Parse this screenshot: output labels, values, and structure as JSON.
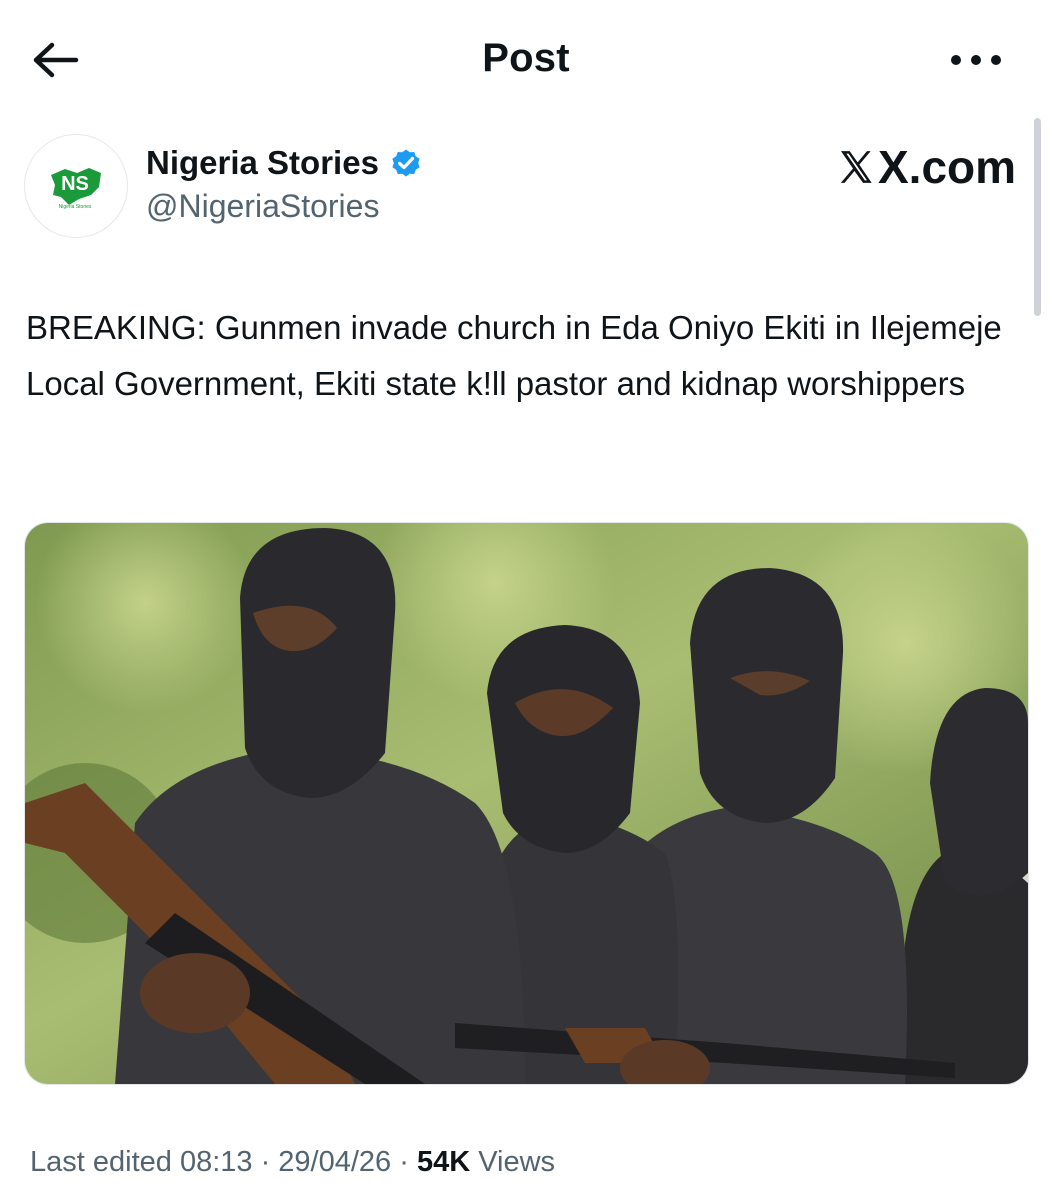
{
  "header": {
    "title": "Post",
    "back_icon": "arrow-left-icon",
    "more_icon": "more-horizontal-icon"
  },
  "author": {
    "name": "Nigeria Stories",
    "handle": "@NigeriaStories",
    "verified_icon": "verified-badge-icon",
    "avatar_text": "NS",
    "avatar_subtext": "Nigeria Stories"
  },
  "watermark": "X.com",
  "post": {
    "text": "BREAKING: Gunmen invade church in Eda Oniyo Ekiti in Ilejemeje Local Government, Ekiti state k!ll pastor and kidnap worshippers"
  },
  "meta": {
    "edited": "Last edited 08:13",
    "sep1": " · ",
    "date": "29/04/26",
    "sep2": " · ",
    "views_count": "54K",
    "views_label": " Views"
  },
  "colors": {
    "text": "#0f1419",
    "secondary": "#536471",
    "verified": "#1d9bf0",
    "nigeria_green": "#1a9a3a"
  }
}
